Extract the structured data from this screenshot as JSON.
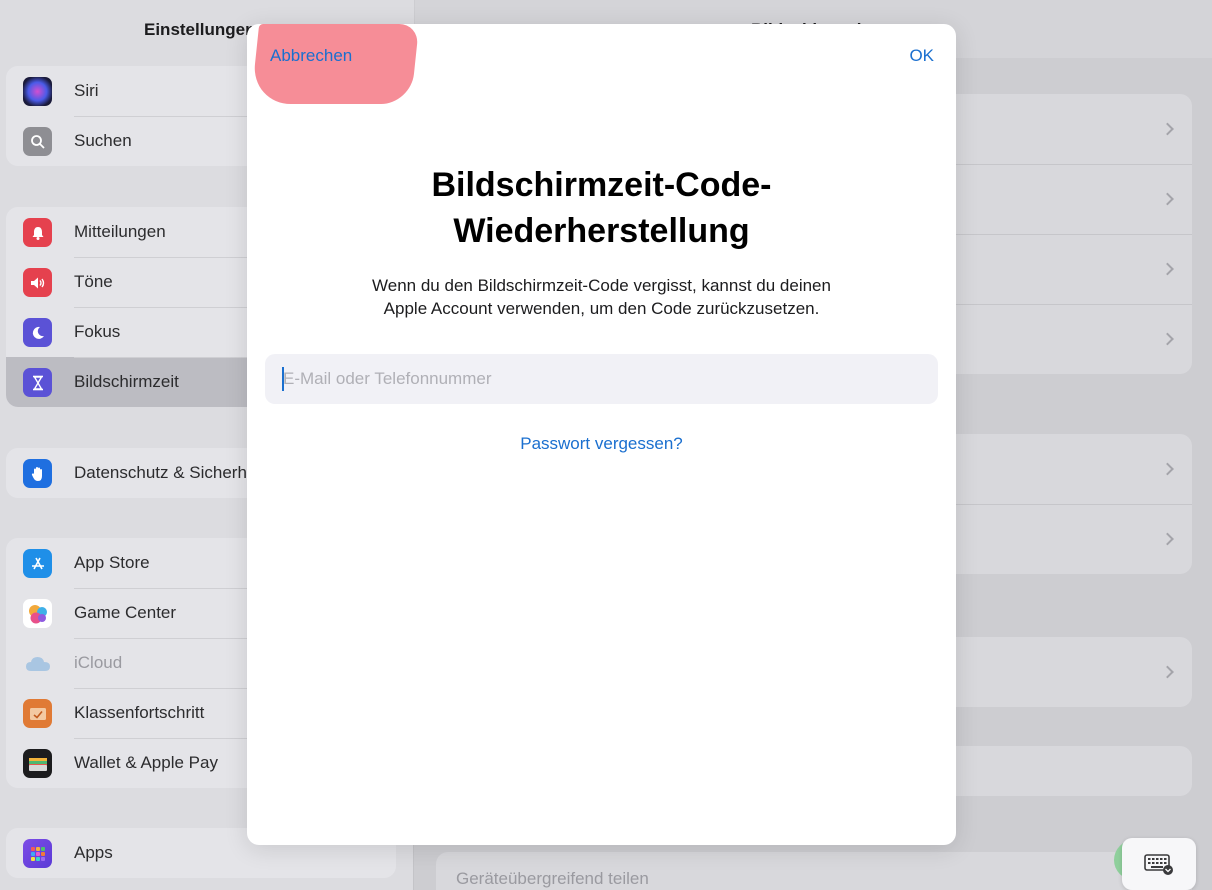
{
  "sidebar": {
    "title": "Einstellungen",
    "groups": [
      {
        "items": [
          {
            "label": "Siri",
            "icon": "siri-icon",
            "color": "#2a2a6a"
          },
          {
            "label": "Suchen",
            "icon": "magnifier-icon",
            "color": "#8e8e93"
          }
        ]
      },
      {
        "items": [
          {
            "label": "Mitteilungen",
            "icon": "bell-icon",
            "color": "#e5414e"
          },
          {
            "label": "Töne",
            "icon": "speaker-icon",
            "color": "#e5414e"
          },
          {
            "label": "Fokus",
            "icon": "moon-icon",
            "color": "#5b52d6"
          },
          {
            "label": "Bildschirmzeit",
            "icon": "hourglass-icon",
            "color": "#5b52d6",
            "selected": true
          }
        ]
      },
      {
        "items": [
          {
            "label": "Datenschutz & Sicherheit",
            "icon": "hand-icon",
            "color": "#1f6fe0"
          }
        ]
      },
      {
        "items": [
          {
            "label": "App Store",
            "icon": "app-store-icon",
            "color": "#1f8fe8"
          },
          {
            "label": "Game Center",
            "icon": "game-center-icon",
            "color": "#e86c9a"
          },
          {
            "label": "iCloud",
            "icon": "cloud-icon",
            "color": "#9fc0e0",
            "dimmed": true
          },
          {
            "label": "Klassenfortschritt",
            "icon": "classwork-icon",
            "color": "#e07a35"
          },
          {
            "label": "Wallet & Apple Pay",
            "icon": "wallet-icon",
            "color": "#1c1c1e"
          }
        ]
      },
      {
        "items": [
          {
            "label": "Apps",
            "icon": "apps-grid-icon",
            "color": "#6a4ae0"
          }
        ]
      }
    ]
  },
  "detail": {
    "title": "Bildschirmzeit",
    "share_label": "Geräteübergreifend teilen"
  },
  "sheet": {
    "cancel_label": "Abbrechen",
    "ok_label": "OK",
    "heading_line1": "Bildschirmzeit-Code-",
    "heading_line2": "Wiederherstellung",
    "description_line1": "Wenn du den Bildschirmzeit-Code vergisst, kannst du deinen",
    "description_line2": "Apple Account verwenden, um den Code zurückzusetzen.",
    "field_placeholder": "E-Mail oder Telefonnummer",
    "field_value": "",
    "forgot_label": "Passwort vergessen?"
  },
  "keyboard_button": {
    "icon": "keyboard-icon"
  },
  "colors": {
    "accent": "#1a6fcf",
    "redaction": "#f4717d"
  }
}
